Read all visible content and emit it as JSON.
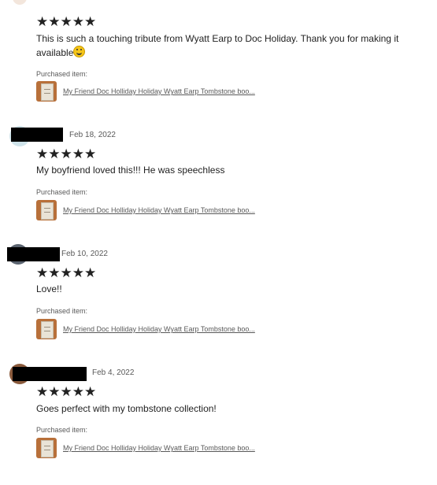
{
  "reviews": [
    {
      "date": "",
      "stars": "★★★★★",
      "rating": 5,
      "text": "This is such a touching tribute from Wyatt Earp to Doc Holiday. Thank you for making it available",
      "emoji": "grinning-face-emoji",
      "purchased_label": "Purchased item:",
      "item_link": "My Friend Doc Holliday Holiday Wyatt Earp Tombstone boo..."
    },
    {
      "date": "Feb 18, 2022",
      "stars": "★★★★★",
      "rating": 5,
      "text": "My boyfriend loved this!!! He was speechless",
      "purchased_label": "Purchased item:",
      "item_link": "My Friend Doc Holliday Holiday Wyatt Earp Tombstone boo..."
    },
    {
      "date": "Feb 10, 2022",
      "stars": "★★★★★",
      "rating": 5,
      "text": "Love!!",
      "purchased_label": "Purchased item:",
      "item_link": "My Friend Doc Holliday Holiday Wyatt Earp Tombstone boo..."
    },
    {
      "date": "Feb 4, 2022",
      "stars": "★★★★★",
      "rating": 5,
      "text": "Goes perfect with my tombstone collection!",
      "purchased_label": "Purchased item:",
      "item_link": "My Friend Doc Holliday Holiday Wyatt Earp Tombstone boo..."
    }
  ],
  "colors": {
    "text": "#222222",
    "muted": "#595959",
    "redaction": "#000000"
  }
}
